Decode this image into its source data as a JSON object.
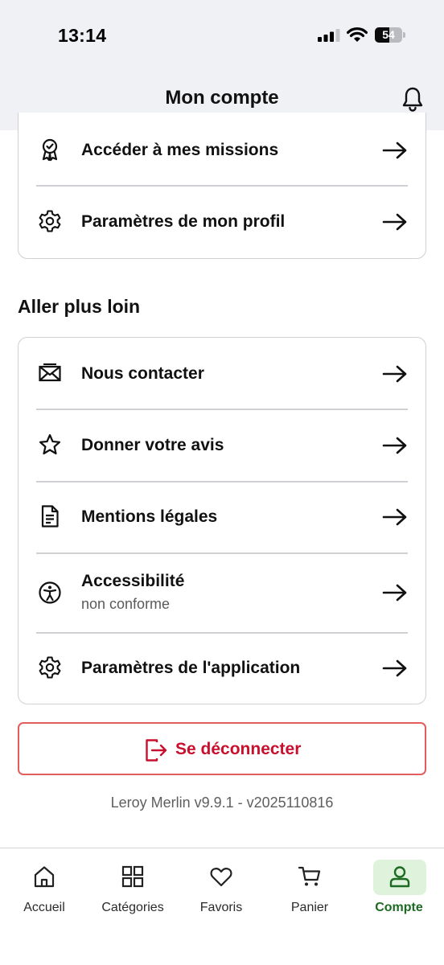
{
  "status_bar": {
    "time": "13:14",
    "battery_level": "54",
    "battery_fraction": 0.54
  },
  "header": {
    "title": "Mon compte",
    "bell_icon": "bell-icon"
  },
  "account_items": [
    {
      "label": "Accéder à mes missions",
      "icon": "award-badge-icon"
    },
    {
      "label": "Paramètres de mon profil",
      "icon": "gear-icon"
    }
  ],
  "further_section": {
    "title": "Aller plus loin",
    "items": [
      {
        "label": "Nous contacter",
        "icon": "envelope-icon"
      },
      {
        "label": "Donner votre avis",
        "icon": "star-icon"
      },
      {
        "label": "Mentions légales",
        "icon": "document-icon"
      },
      {
        "label": "Accessibilité",
        "sublabel": "non conforme",
        "icon": "accessibility-icon"
      },
      {
        "label": "Paramètres de l'application",
        "icon": "gear-icon"
      }
    ]
  },
  "logout": {
    "label": "Se déconnecter",
    "icon": "logout-icon"
  },
  "version": "Leroy Merlin v9.9.1 - v2025110816",
  "tabbar": {
    "tabs": [
      {
        "label": "Accueil",
        "icon": "home-icon"
      },
      {
        "label": "Catégories",
        "icon": "grid-icon"
      },
      {
        "label": "Favoris",
        "icon": "heart-icon"
      },
      {
        "label": "Panier",
        "icon": "cart-icon"
      },
      {
        "label": "Compte",
        "icon": "user-icon",
        "active": true
      }
    ]
  },
  "colors": {
    "accent_green": "#1d6b23",
    "logout_red": "#c8102e",
    "header_bg": "#f0f1f5"
  }
}
